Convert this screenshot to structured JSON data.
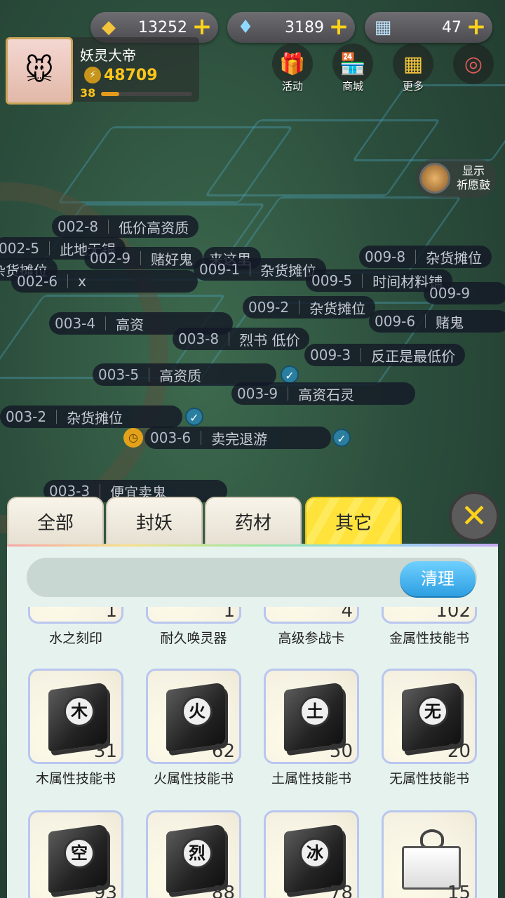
{
  "currency": [
    {
      "icon": "crystal-icon",
      "value": "13252"
    },
    {
      "icon": "diamond-icon",
      "value": "3189"
    },
    {
      "icon": "ticket-icon",
      "value": "47"
    }
  ],
  "profile": {
    "name": "妖灵大帝",
    "power": "48709",
    "level": "38",
    "exp_fraction": 0.2
  },
  "top_menu": [
    {
      "icon": "gift-icon",
      "label": "活动"
    },
    {
      "icon": "shop-icon",
      "label": "商城"
    },
    {
      "icon": "more-icon",
      "label": "更多"
    },
    {
      "icon": "compass-icon",
      "label": ""
    }
  ],
  "prayer": {
    "label": "显示\n祈愿鼓"
  },
  "stalls": [
    {
      "id": "002-8",
      "text": "低价高资质"
    },
    {
      "id": "002-5",
      "text": "此地无银"
    },
    {
      "id": "002-9",
      "text": "赌好鬼"
    },
    {
      "id": "",
      "text": "来这里"
    },
    {
      "id": "009-8",
      "text": "杂货摊位"
    },
    {
      "id": "",
      "text": "杂货摊位"
    },
    {
      "id": "009-1",
      "text": "杂货摊位"
    },
    {
      "id": "002-6",
      "text": "x"
    },
    {
      "id": "009-5",
      "text": "时间材料铺"
    },
    {
      "id": "009-9",
      "text": ""
    },
    {
      "id": "009-2",
      "text": "杂货摊位"
    },
    {
      "id": "003-4",
      "text": "高资"
    },
    {
      "id": "009-6",
      "text": "赌鬼"
    },
    {
      "id": "003-8",
      "text": "烈书 低价"
    },
    {
      "id": "009-3",
      "text": "反正是最低价"
    },
    {
      "id": "003-5",
      "text": "高资质"
    },
    {
      "id": "003-9",
      "text": "高资石灵"
    },
    {
      "id": "003-2",
      "text": "杂货摊位"
    },
    {
      "id": "003-6",
      "text": "卖完退游"
    },
    {
      "id": "003-3",
      "text": "便宜卖鬼"
    }
  ],
  "tabs": [
    {
      "label": "全部",
      "active": false
    },
    {
      "label": "封妖",
      "active": false
    },
    {
      "label": "药材",
      "active": false
    },
    {
      "label": "其它",
      "active": true
    }
  ],
  "close_icon": "close-icon",
  "search": {
    "value": "",
    "clear_label": "清理"
  },
  "items": [
    {
      "name": "水之刻印",
      "count": "1",
      "icon": "seal-icon"
    },
    {
      "name": "耐久唤灵器",
      "count": "1",
      "icon": "summoner-icon"
    },
    {
      "name": "高级参战卡",
      "count": "4",
      "icon": "card-icon"
    },
    {
      "name": "金属性技能书",
      "count": "102",
      "icon": "book-icon"
    },
    {
      "name": "木属性技能书",
      "count": "31",
      "icon": "book-icon",
      "glyph": "木"
    },
    {
      "name": "火属性技能书",
      "count": "62",
      "icon": "book-icon",
      "glyph": "火"
    },
    {
      "name": "土属性技能书",
      "count": "50",
      "icon": "book-icon",
      "glyph": "土"
    },
    {
      "name": "无属性技能书",
      "count": "20",
      "icon": "book-icon",
      "glyph": "无"
    },
    {
      "name": "",
      "count": "93",
      "icon": "book-icon",
      "glyph": "空"
    },
    {
      "name": "",
      "count": "88",
      "icon": "book-icon",
      "glyph": "烈"
    },
    {
      "name": "",
      "count": "78",
      "icon": "book-icon",
      "glyph": "冰"
    },
    {
      "name": "",
      "count": "15",
      "icon": "gift-box-icon"
    }
  ]
}
